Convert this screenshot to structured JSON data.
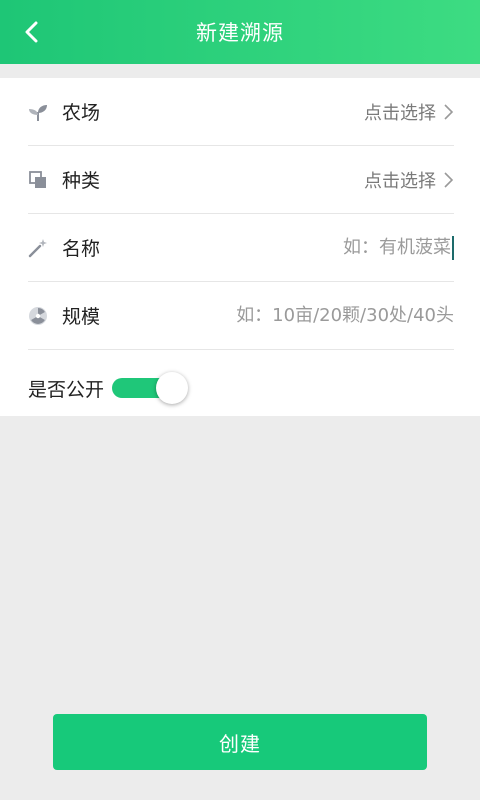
{
  "header": {
    "title": "新建溯源",
    "back_icon": "chevron-left-icon"
  },
  "form": {
    "farm": {
      "label": "农场",
      "value": "点击选择",
      "icon": "sprout-icon"
    },
    "category": {
      "label": "种类",
      "value": "点击选择",
      "icon": "copy-icon"
    },
    "name": {
      "label": "名称",
      "placeholder": "如：有机菠菜",
      "icon": "magic-wand-icon"
    },
    "scale": {
      "label": "规模",
      "placeholder": "如：10亩/20颗/30处/40头",
      "icon": "radiation-icon"
    },
    "public": {
      "label": "是否公开",
      "enabled": true
    }
  },
  "actions": {
    "create_label": "创建"
  },
  "colors": {
    "accent": "#1fc779",
    "header_start": "#1ec676",
    "header_end": "#3ddc82"
  }
}
